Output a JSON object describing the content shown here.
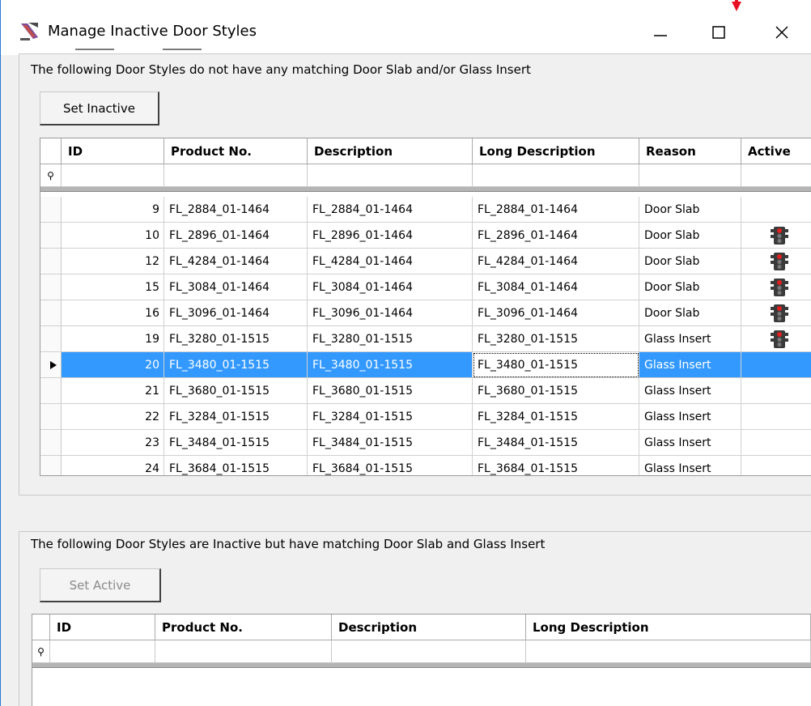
{
  "window": {
    "title": "Manage Inactive Door Styles",
    "icons": {
      "app": "door-style-app-icon",
      "minimize": "minimize-icon",
      "maximize": "maximize-icon",
      "close": "close-icon",
      "pointer": "red-arrow-pointer"
    }
  },
  "top_group": {
    "caption": "The following Door Styles do not have any matching Door Slab and/or Glass Insert",
    "button": "Set Inactive",
    "columns": [
      "ID",
      "Product No.",
      "Description",
      "Long Description",
      "Reason",
      "Active"
    ],
    "rows": [
      {
        "id": "9",
        "product": "FL_2884_01-1464",
        "description": "FL_2884_01-1464",
        "long": "FL_2884_01-1464",
        "reason": "Door Slab",
        "active_icon": ""
      },
      {
        "id": "10",
        "product": "FL_2896_01-1464",
        "description": "FL_2896_01-1464",
        "long": "FL_2896_01-1464",
        "reason": "Door Slab",
        "active_icon": "traffic-light-icon"
      },
      {
        "id": "12",
        "product": "FL_4284_01-1464",
        "description": "FL_4284_01-1464",
        "long": "FL_4284_01-1464",
        "reason": "Door Slab",
        "active_icon": "traffic-light-icon"
      },
      {
        "id": "15",
        "product": "FL_3084_01-1464",
        "description": "FL_3084_01-1464",
        "long": "FL_3084_01-1464",
        "reason": "Door Slab",
        "active_icon": "traffic-light-icon"
      },
      {
        "id": "16",
        "product": "FL_3096_01-1464",
        "description": "FL_3096_01-1464",
        "long": "FL_3096_01-1464",
        "reason": "Door Slab",
        "active_icon": "traffic-light-icon"
      },
      {
        "id": "19",
        "product": "FL_3280_01-1515",
        "description": "FL_3280_01-1515",
        "long": "FL_3280_01-1515",
        "reason": "Glass Insert",
        "active_icon": "traffic-light-icon"
      },
      {
        "id": "20",
        "product": "FL_3480_01-1515",
        "description": "FL_3480_01-1515",
        "long": "FL_3480_01-1515",
        "reason": "Glass Insert",
        "active_icon": "",
        "selected": true
      },
      {
        "id": "21",
        "product": "FL_3680_01-1515",
        "description": "FL_3680_01-1515",
        "long": "FL_3680_01-1515",
        "reason": "Glass Insert",
        "active_icon": ""
      },
      {
        "id": "22",
        "product": "FL_3284_01-1515",
        "description": "FL_3284_01-1515",
        "long": "FL_3284_01-1515",
        "reason": "Glass Insert",
        "active_icon": ""
      },
      {
        "id": "23",
        "product": "FL_3484_01-1515",
        "description": "FL_3484_01-1515",
        "long": "FL_3484_01-1515",
        "reason": "Glass Insert",
        "active_icon": ""
      },
      {
        "id": "24",
        "product": "FL_3684_01-1515",
        "description": "FL_3684_01-1515",
        "long": "FL_3684_01-1515",
        "reason": "Glass Insert",
        "active_icon": ""
      }
    ]
  },
  "bottom_group": {
    "caption": "The following Door Styles are Inactive but have matching Door Slab and Glass Insert",
    "button": "Set Active",
    "columns": [
      "ID",
      "Product No.",
      "Description",
      "Long Description"
    ]
  },
  "colors": {
    "selection": "#3399ff",
    "window_bg": "#f0f0f0",
    "accent_border": "#2b78d0",
    "pointer": "#e81123"
  }
}
